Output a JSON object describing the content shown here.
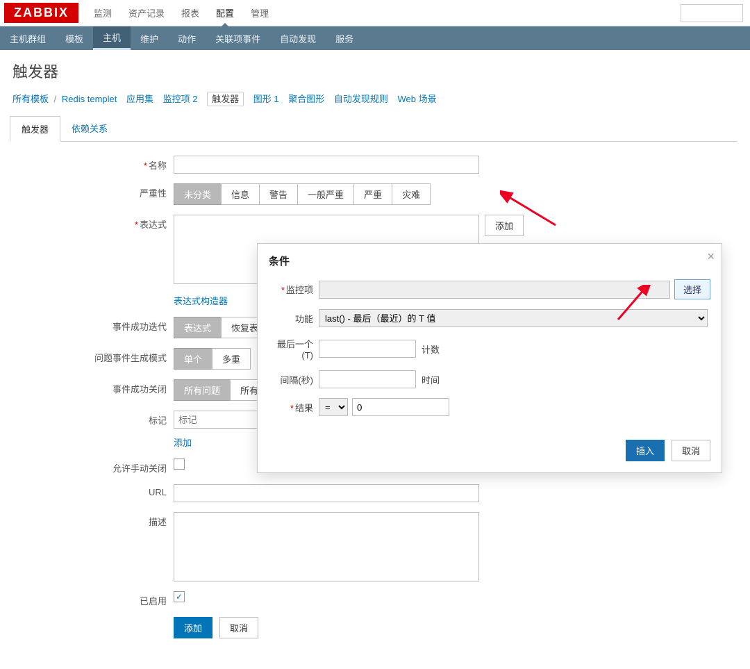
{
  "logo": "ZABBIX",
  "topnav": {
    "items": [
      "监测",
      "资产记录",
      "报表",
      "配置",
      "管理"
    ],
    "active": 3
  },
  "subnav": {
    "items": [
      "主机群组",
      "模板",
      "主机",
      "维护",
      "动作",
      "关联项事件",
      "自动发现",
      "服务"
    ],
    "active": 2
  },
  "page_title": "触发器",
  "breadcrumb": {
    "all_templates": "所有模板",
    "template_name": "Redis templet",
    "items": [
      "应用集",
      "监控项 2",
      "触发器",
      "图形 1",
      "聚合图形",
      "自动发现规则",
      "Web 场景"
    ]
  },
  "tabs": [
    "触发器",
    "依赖关系"
  ],
  "form": {
    "name_label": "名称",
    "severity_label": "严重性",
    "severities": [
      "未分类",
      "信息",
      "警告",
      "一般严重",
      "严重",
      "灾难"
    ],
    "expression_label": "表达式",
    "add_expr_btn": "添加",
    "expr_constructor": "表达式构造器",
    "ok_iter_label": "事件成功迭代",
    "ok_iter_opts": [
      "表达式",
      "恢复表达式"
    ],
    "problem_gen_label": "问题事件生成模式",
    "problem_gen_opts": [
      "单个",
      "多重"
    ],
    "ok_close_label": "事件成功关闭",
    "ok_close_opts": [
      "所有问题",
      "所有问题"
    ],
    "tags_label": "标记",
    "tags_placeholder": "标记",
    "tags_add": "添加",
    "manual_close_label": "允许手动关闭",
    "url_label": "URL",
    "desc_label": "描述",
    "enabled_label": "已启用",
    "add_btn": "添加",
    "cancel_btn": "取消"
  },
  "dialog": {
    "title": "条件",
    "item_label": "监控项",
    "select_btn": "选择",
    "func_label": "功能",
    "func_value": "last() - 最后（最近）的 T 值",
    "last_t_label": "最后一个 (T)",
    "count_label": "计数",
    "interval_label": "间隔(秒)",
    "time_label": "时间",
    "result_label": "结果",
    "result_op": "=",
    "result_val": "0",
    "insert_btn": "插入",
    "cancel_btn": "取消"
  }
}
